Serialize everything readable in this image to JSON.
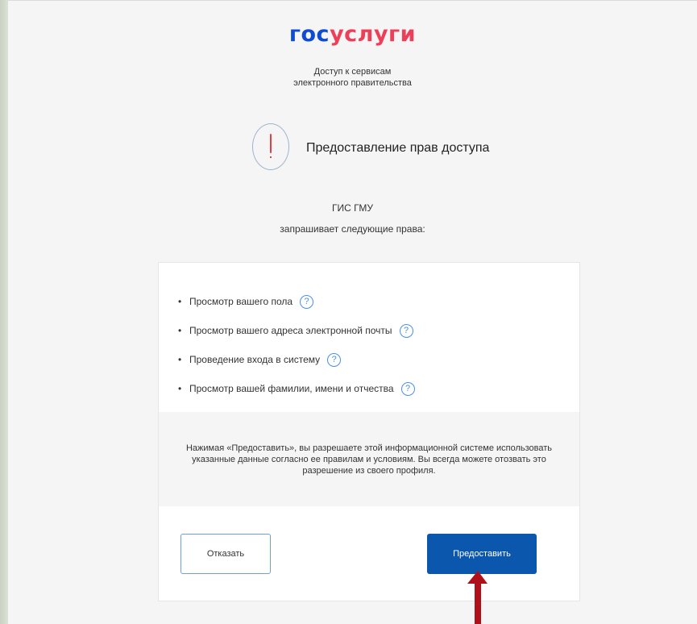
{
  "header": {
    "logo_part1": "гос",
    "logo_part2": "услуги",
    "tagline_line1": "Доступ к сервисам",
    "tagline_line2": "электронного правительства"
  },
  "dialog": {
    "heading": "Предоставление прав доступа",
    "requester": "ГИС ГМУ",
    "requests_text": "запрашивает следующие права:",
    "permissions": [
      {
        "label": "Просмотр вашего пола",
        "help": "?"
      },
      {
        "label": "Просмотр вашего адреса электронной почты",
        "help": "?"
      },
      {
        "label": "Проведение входа в систему",
        "help": "?"
      },
      {
        "label": "Просмотр вашей фамилии, имени и отчества",
        "help": "?"
      }
    ],
    "notice_line1": "Нажимая «Предоставить», вы разрешаете этой информационной системе использовать",
    "notice_line2": "указанные данные согласно ее правилам и условиям. Вы всегда можете отозвать это",
    "notice_line3": "разрешение из своего профиля.",
    "decline_label": "Отказать",
    "grant_label": "Предоставить"
  },
  "colors": {
    "logo_blue": "#0d4cd3",
    "logo_red": "#ee3f58",
    "primary_button": "#0b57ad",
    "help_icon": "#4a90e2",
    "alert_mark": "#e53e3e",
    "annotation_arrow": "#b0101a"
  },
  "icons": {
    "alert": "exclamation-circle-icon",
    "help": "question-circle-icon",
    "annotation": "arrow-up-icon"
  }
}
